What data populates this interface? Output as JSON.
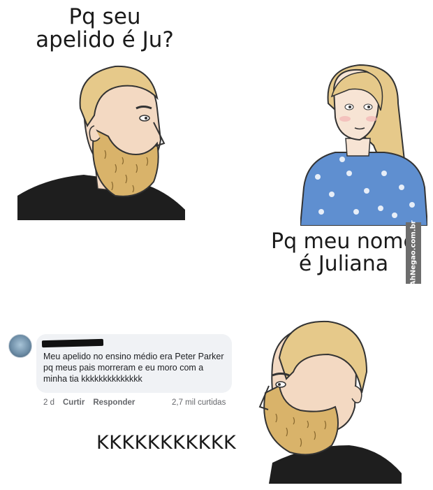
{
  "panel1": {
    "caption_line1": "Pq seu",
    "caption_line2": "apelido é Ju?"
  },
  "panel2": {
    "caption_line1": "Pq meu nome",
    "caption_line2": "é Juliana"
  },
  "watermark": "AhNegao.com.br",
  "comment": {
    "author_redacted": true,
    "text": "Meu apelido no ensino médio era Peter Parker pq meus pais morreram e eu moro com a minha tia kkkkkkkkkkkkkk",
    "time": "2 d",
    "like_label": "Curtir",
    "reply_label": "Responder",
    "likes_count": "2,7 mil curtidas"
  },
  "panel3": {
    "caption": "KKKKKKKKKKK"
  },
  "colors": {
    "bubble": "#f0f2f5",
    "beard": "#d9b36a",
    "hair": "#e6c98a",
    "dress": "#5f8fd0",
    "shirt": "#1e1e1e"
  }
}
